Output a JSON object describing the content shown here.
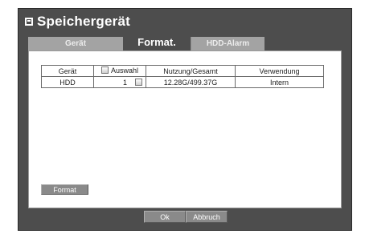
{
  "title": "Speichergerät",
  "tabs": [
    {
      "label": "Gerät"
    },
    {
      "label": "Format."
    },
    {
      "label": "HDD-Alarm"
    }
  ],
  "table": {
    "headers": {
      "device": "Gerät",
      "select": "Auswahl",
      "usage": "Nutzung/Gesamt",
      "use": "Verwendung"
    },
    "rows": [
      {
        "device": "HDD",
        "select": "1",
        "usage": "12.28G/499.37G",
        "use": "Intern"
      }
    ]
  },
  "buttons": {
    "format": "Format",
    "ok": "Ok",
    "cancel": "Abbruch"
  }
}
